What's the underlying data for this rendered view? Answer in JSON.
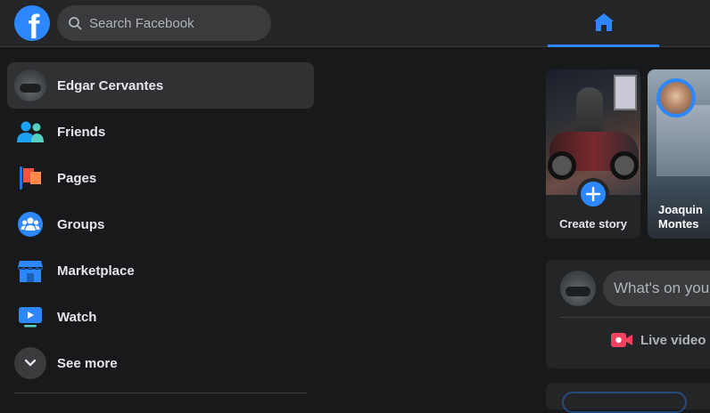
{
  "topbar": {
    "logo_letter": "f",
    "search_placeholder": "Search Facebook"
  },
  "sidebar": {
    "items": [
      {
        "label": "Edgar Cervantes",
        "icon": "profile-avatar"
      },
      {
        "label": "Friends",
        "icon": "friends-icon"
      },
      {
        "label": "Pages",
        "icon": "pages-flag-icon"
      },
      {
        "label": "Groups",
        "icon": "groups-icon"
      },
      {
        "label": "Marketplace",
        "icon": "marketplace-icon"
      },
      {
        "label": "Watch",
        "icon": "watch-icon"
      },
      {
        "label": "See more",
        "icon": "chevron-down-icon"
      }
    ]
  },
  "stories": {
    "create_label": "Create story",
    "friend_story_name_line1": "Joaquin",
    "friend_story_name_line2": "Montes"
  },
  "composer": {
    "placeholder": "What's on you",
    "live_label": "Live video"
  },
  "colors": {
    "accent": "#2d88ff",
    "background": "#18191a",
    "surface": "#242526",
    "live_red": "#f3425f"
  }
}
